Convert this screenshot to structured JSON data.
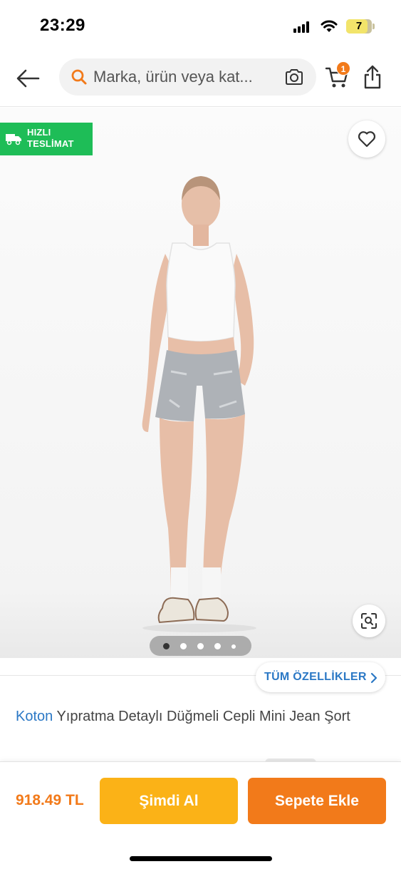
{
  "status_bar": {
    "time": "23:29",
    "battery": "7"
  },
  "header": {
    "search_placeholder": "Marka, ürün veya kat...",
    "cart_count": "1",
    "icons": [
      "back-arrow-icon",
      "search-icon",
      "camera-icon",
      "cart-icon",
      "share-icon"
    ]
  },
  "gallery": {
    "badge_line1": "HIZLI",
    "badge_line2": "TESLİMAT",
    "image_count": 5,
    "active_index": 0,
    "colors": {
      "badge": "#1ebd57"
    }
  },
  "product": {
    "all_features_label": "TÜM ÖZELLİKLER",
    "brand": "Koton",
    "name": "Yıpratma Detaylı Düğmeli Cepli Mini Jean Şort"
  },
  "bottom_bar": {
    "price": "918.49 TL",
    "buy_now_label": "Şimdi Al",
    "add_to_cart_label": "Sepete Ekle",
    "colors": {
      "primary": "#f27a1a",
      "secondary": "#fbb217",
      "link": "#2b78c5"
    }
  }
}
